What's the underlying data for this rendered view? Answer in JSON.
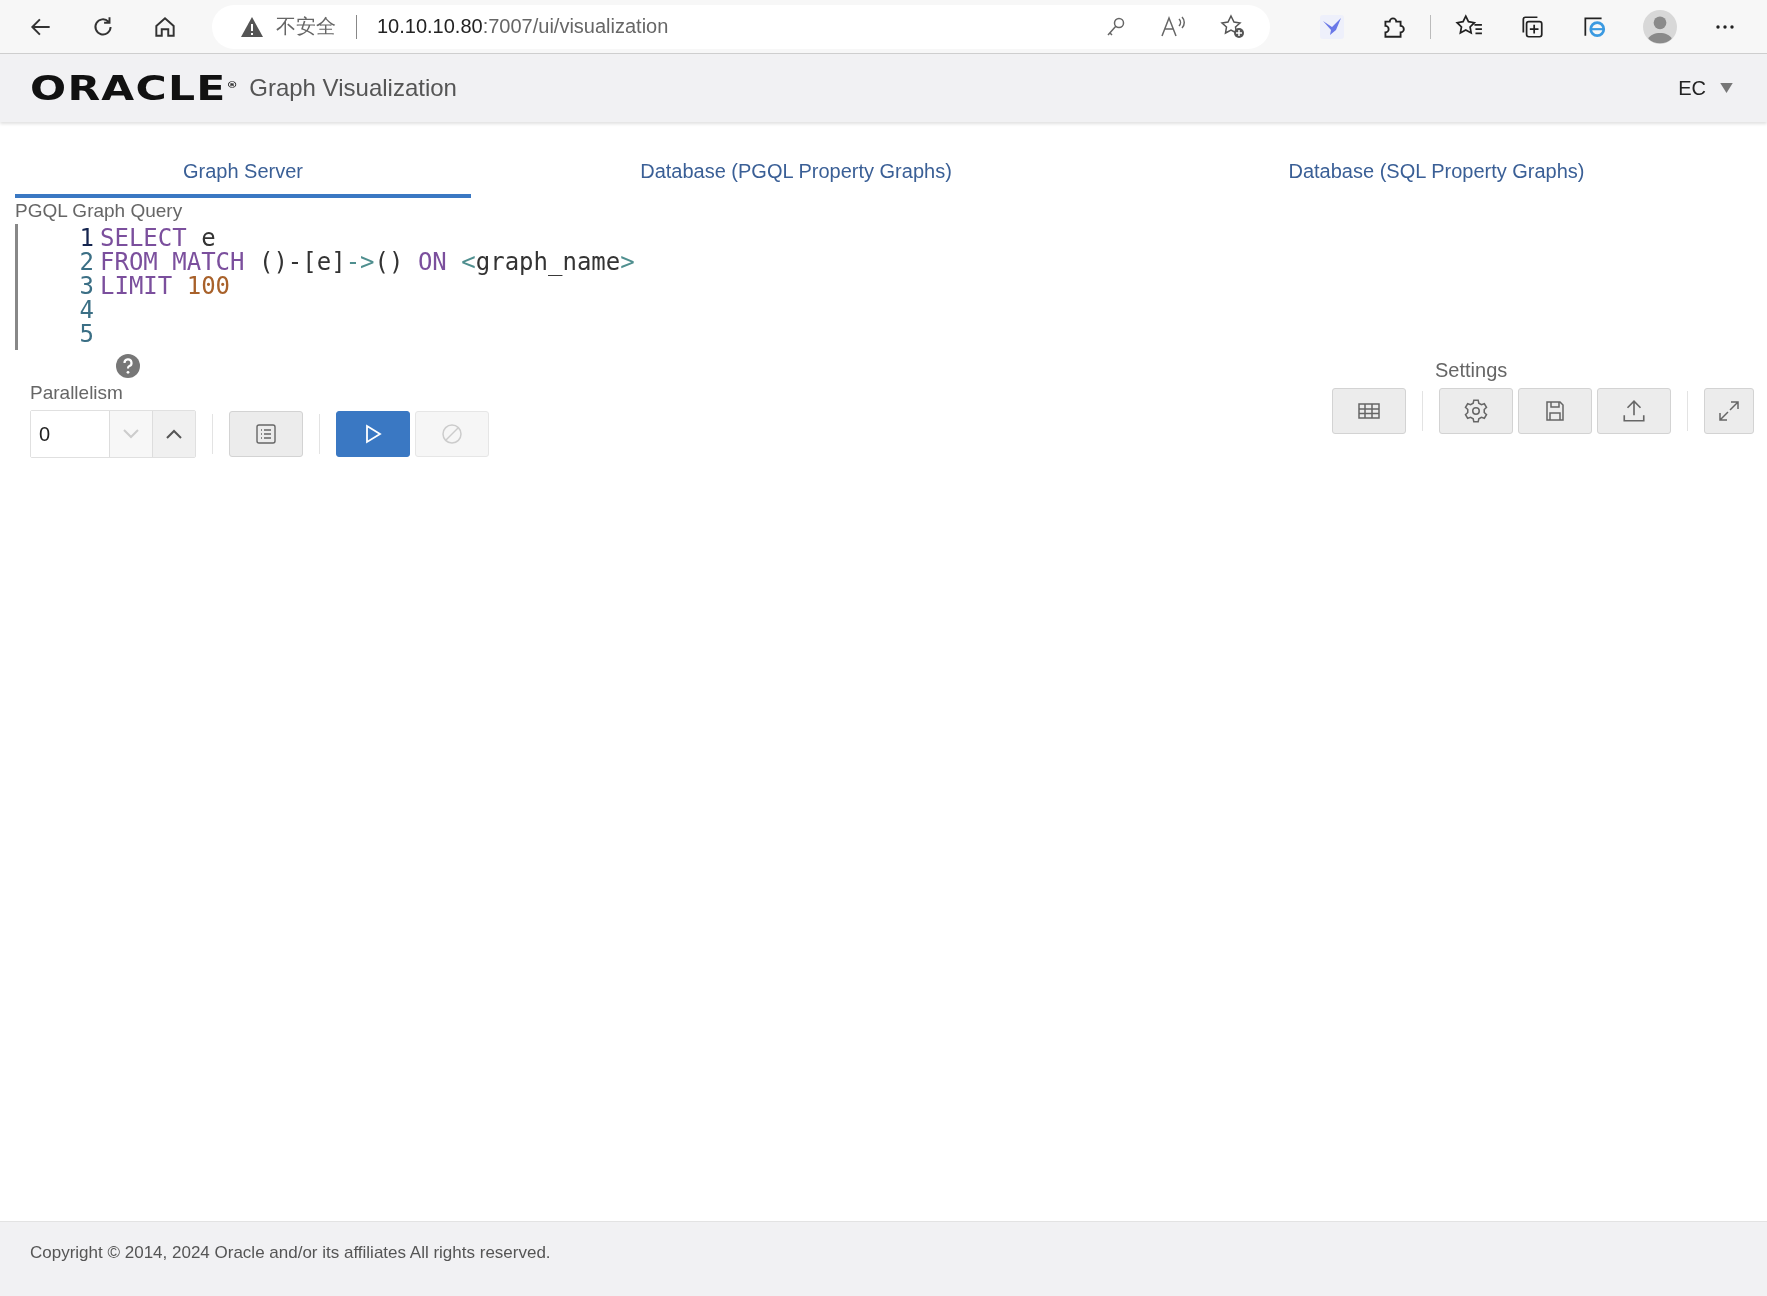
{
  "browser": {
    "security_label": "不安全",
    "url_host": "10.10.10.80",
    "url_path": ":7007/ui/visualization"
  },
  "header": {
    "logo": "ORACLE$^{®}$",
    "title": "Graph Visualization",
    "user": "EC"
  },
  "tabs": [
    {
      "label": "Graph Server",
      "selected": true
    },
    {
      "label": "Database (PGQL Property Graphs)",
      "selected": false
    },
    {
      "label": "Database (SQL Property Graphs)",
      "selected": false
    }
  ],
  "query": {
    "label": "PGQL Graph Query",
    "lines": [
      {
        "number": "1",
        "active": true,
        "tokens": [
          {
            "kind": "keyword",
            "text": "SELECT"
          },
          {
            "kind": "plain",
            "text": " e"
          }
        ]
      },
      {
        "number": "2",
        "active": false,
        "tokens": [
          {
            "kind": "keyword",
            "text": "FROM MATCH"
          },
          {
            "kind": "plain",
            "text": " ()-[e]"
          },
          {
            "kind": "operator",
            "text": "->"
          },
          {
            "kind": "plain",
            "text": "() "
          },
          {
            "kind": "keyword",
            "text": "ON "
          },
          {
            "kind": "operator",
            "text": "<"
          },
          {
            "kind": "plain",
            "text": "graph_name"
          },
          {
            "kind": "operator",
            "text": ">"
          }
        ]
      },
      {
        "number": "3",
        "active": false,
        "tokens": [
          {
            "kind": "keyword",
            "text": "LIMIT "
          },
          {
            "kind": "number",
            "text": "100"
          }
        ]
      },
      {
        "number": "4",
        "active": false
      },
      {
        "number": "5",
        "active": false
      }
    ]
  },
  "parallelism": {
    "label": "Parallelism",
    "value": "0",
    "decrement_disabled": true
  },
  "actions": [
    {
      "kind": "list",
      "disabled": false
    },
    {
      "kind": "run",
      "disabled": false
    },
    {
      "kind": "cancel",
      "disabled": true
    }
  ],
  "settings": {
    "label": "Settings",
    "buttons": [
      {
        "kind": "table"
      },
      {
        "kind": "gear"
      },
      {
        "kind": "save"
      },
      {
        "kind": "upload"
      },
      {
        "kind": "expand"
      }
    ]
  },
  "footer": {
    "text": "Copyright © 2014, 2024 Oracle and/or its affiliates All rights reserved."
  }
}
